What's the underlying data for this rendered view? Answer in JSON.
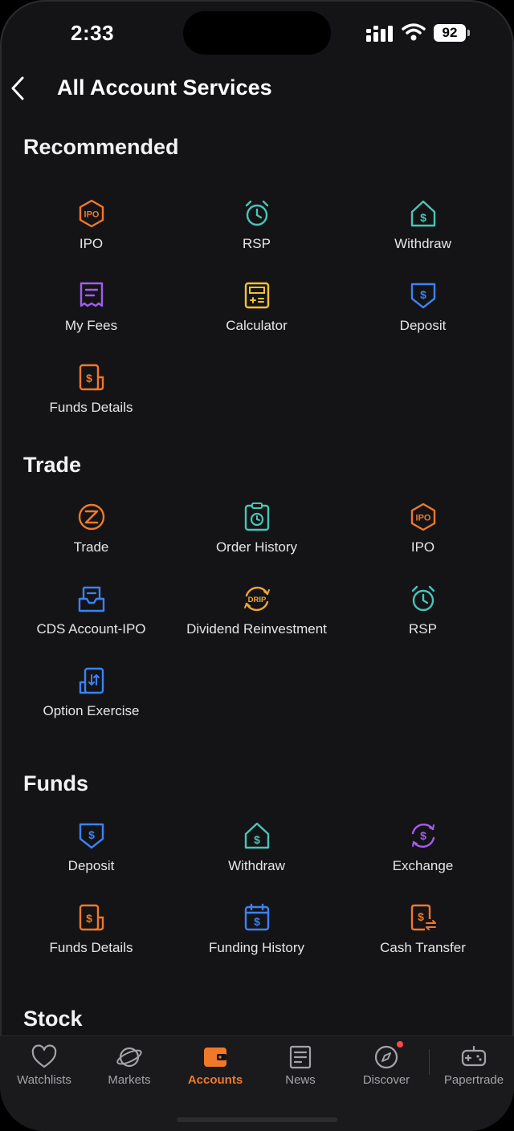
{
  "status": {
    "time": "2:33",
    "battery": "92"
  },
  "header": {
    "title": "All Account Services"
  },
  "colors": {
    "background": "#141416",
    "accent": "#f0782b",
    "orange": "#f0782b",
    "teal": "#49c5b6",
    "blue": "#3b82f6",
    "purple": "#a35cf0",
    "yellow": "#f2c233"
  },
  "sections": {
    "recommended": {
      "title": "Recommended",
      "items": [
        {
          "label": "IPO",
          "icon": "ipo-icon"
        },
        {
          "label": "RSP",
          "icon": "alarm-clock-icon"
        },
        {
          "label": "Withdraw",
          "icon": "house-dollar-icon"
        },
        {
          "label": "My Fees",
          "icon": "receipt-icon"
        },
        {
          "label": "Calculator",
          "icon": "calculator-icon"
        },
        {
          "label": "Deposit",
          "icon": "shield-dollar-icon"
        },
        {
          "label": "Funds Details",
          "icon": "document-dollar-icon"
        }
      ]
    },
    "trade": {
      "title": "Trade",
      "items": [
        {
          "label": "Trade",
          "icon": "trade-z-icon"
        },
        {
          "label": "Order History",
          "icon": "clipboard-clock-icon"
        },
        {
          "label": "IPO",
          "icon": "ipo-icon"
        },
        {
          "label": "CDS Account-IPO",
          "icon": "inbox-icon"
        },
        {
          "label": "Dividend Reinvestment",
          "icon": "drip-icon"
        },
        {
          "label": "RSP",
          "icon": "alarm-clock-icon"
        },
        {
          "label": "Option Exercise",
          "icon": "option-arrows-icon"
        }
      ]
    },
    "funds": {
      "title": "Funds",
      "items": [
        {
          "label": "Deposit",
          "icon": "shield-dollar-icon"
        },
        {
          "label": "Withdraw",
          "icon": "house-dollar-icon"
        },
        {
          "label": "Exchange",
          "icon": "exchange-icon"
        },
        {
          "label": "Funds Details",
          "icon": "document-dollar-icon"
        },
        {
          "label": "Funding History",
          "icon": "calendar-dollar-icon"
        },
        {
          "label": "Cash Transfer",
          "icon": "cash-transfer-icon"
        }
      ]
    },
    "stock": {
      "title": "Stock"
    }
  },
  "tabbar": {
    "items": [
      {
        "label": "Watchlists",
        "icon": "heart-icon"
      },
      {
        "label": "Markets",
        "icon": "planet-icon"
      },
      {
        "label": "Accounts",
        "icon": "wallet-icon",
        "active": true
      },
      {
        "label": "News",
        "icon": "news-icon"
      },
      {
        "label": "Discover",
        "icon": "compass-icon",
        "badge": true
      },
      {
        "label": "Papertrade",
        "icon": "gamepad-icon"
      }
    ]
  }
}
